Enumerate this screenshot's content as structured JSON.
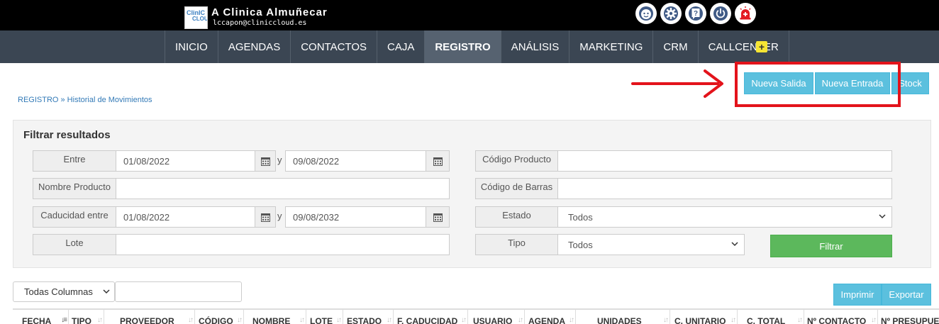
{
  "header": {
    "logo_top": "ClinIC",
    "logo_bottom": "CLOUD",
    "clinic_name": "A Clinica Almuñecar",
    "user_email": "lccapon@cliniccloud.es",
    "icons": [
      "user-face-icon",
      "gear-icon",
      "help-icon",
      "power-icon",
      "alarm-icon"
    ]
  },
  "nav": {
    "items": [
      {
        "label": "INICIO"
      },
      {
        "label": "AGENDAS"
      },
      {
        "label": "CONTACTOS"
      },
      {
        "label": "CAJA"
      },
      {
        "label": "REGISTRO",
        "active": true
      },
      {
        "label": "ANÁLISIS"
      },
      {
        "label": "MARKETING"
      },
      {
        "label": "CRM"
      },
      {
        "label": "CALLCENTER"
      }
    ],
    "plus": "+"
  },
  "breadcrumb": "REGISTRO » Historial de Movimientos",
  "actions": {
    "nueva_salida": "Nueva Salida",
    "nueva_entrada": "Nueva Entrada",
    "stock": "Stock"
  },
  "filter": {
    "title": "Filtrar resultados",
    "entre_label": "Entre",
    "entre_from": "01/08/2022",
    "y1": "y",
    "entre_to": "09/08/2022",
    "codigo_producto_label": "Código Producto",
    "codigo_producto_value": "",
    "nombre_producto_label": "Nombre Producto",
    "nombre_producto_value": "",
    "codigo_barras_label": "Código de Barras",
    "codigo_barras_value": "",
    "caducidad_label": "Caducidad entre",
    "caducidad_from": "01/08/2022",
    "y2": "y",
    "caducidad_to": "09/08/2032",
    "estado_label": "Estado",
    "estado_value": "Todos",
    "lote_label": "Lote",
    "lote_value": "",
    "tipo_label": "Tipo",
    "tipo_value": "Todos",
    "filtrar": "Filtrar"
  },
  "table_controls": {
    "columns_select": "Todas Columnas",
    "search_value": "",
    "imprimir": "Imprimir",
    "exportar": "Exportar"
  },
  "table": {
    "headers": [
      "FECHA",
      "TIPO",
      "PROVEEDOR",
      "CÓDIGO",
      "NOMBRE",
      "LOTE",
      "ESTADO",
      "F. CADUCIDAD",
      "USUARIO",
      "AGENDA",
      "UNIDADES",
      "C. UNITARIO",
      "C. TOTAL",
      "Nº CONTACTO",
      "Nº PRESUPUE"
    ]
  },
  "colors": {
    "topbar": "#000000",
    "nav": "#3b4653",
    "info": "#5bc0de",
    "success": "#5cb85c",
    "highlight": "#e3131b"
  }
}
